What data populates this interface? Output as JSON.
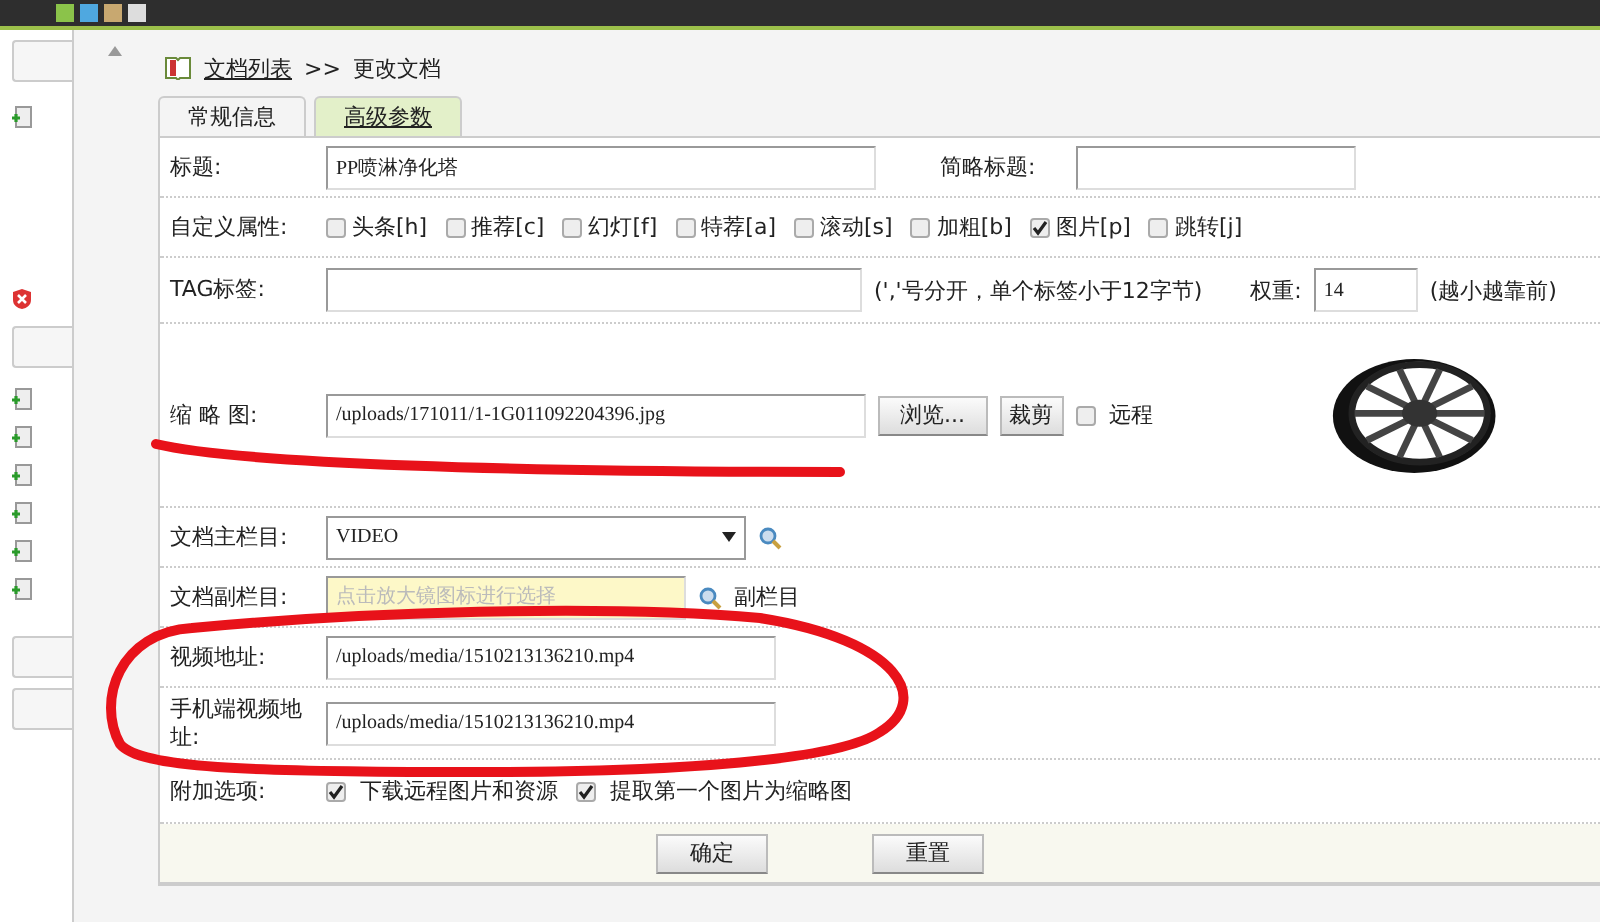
{
  "breadcrumb": {
    "link": "文档列表",
    "separator": ">>",
    "current": "更改文档"
  },
  "tabs": [
    {
      "label": "常规信息",
      "selected": false
    },
    {
      "label": "高级参数",
      "selected": true
    }
  ],
  "form": {
    "title": {
      "label": "标题:",
      "value": "PP喷淋净化塔"
    },
    "short_title": {
      "label": "简略标题:"
    },
    "attributes": {
      "label": "自定义属性:",
      "options": [
        {
          "label": "头条[h]",
          "checked": false
        },
        {
          "label": "推荐[c]",
          "checked": false
        },
        {
          "label": "幻灯[f]",
          "checked": false
        },
        {
          "label": "特荐[a]",
          "checked": false
        },
        {
          "label": "滚动[s]",
          "checked": false
        },
        {
          "label": "加粗[b]",
          "checked": false
        },
        {
          "label": "图片[p]",
          "checked": true
        },
        {
          "label": "跳转[j]",
          "checked": false
        }
      ]
    },
    "tags": {
      "label": "TAG标签:",
      "hint": "(','号分开，单个标签小于12字节)",
      "weight_label": "权重:",
      "weight": "14",
      "weight_hint": "(越小越靠前)"
    },
    "thumbnail": {
      "label": "缩 略 图:",
      "value": "/uploads/171011/1-1G011092204396.jpg",
      "browse": "浏览...",
      "crop": "裁剪",
      "remote": {
        "label": "远程",
        "checked": false
      }
    },
    "main_column": {
      "label": "文档主栏目:",
      "value": "VIDEO"
    },
    "sub_column": {
      "label": "文档副栏目:",
      "placeholder": "点击放大镜图标进行选择",
      "link": "副栏目"
    },
    "video_url": {
      "label": "视频地址:",
      "value": "/uploads/media/1510213136210.mp4"
    },
    "mobile_video_url": {
      "label": "手机端视频地址:",
      "value": "/uploads/media/1510213136210.mp4"
    },
    "extras": {
      "label": "附加选项:",
      "options": [
        {
          "label": "下载远程图片和资源",
          "checked": true
        },
        {
          "label": "提取第一个图片为缩略图",
          "checked": true
        }
      ]
    }
  },
  "buttons": [
    {
      "label": "确定"
    },
    {
      "label": "重置"
    }
  ]
}
